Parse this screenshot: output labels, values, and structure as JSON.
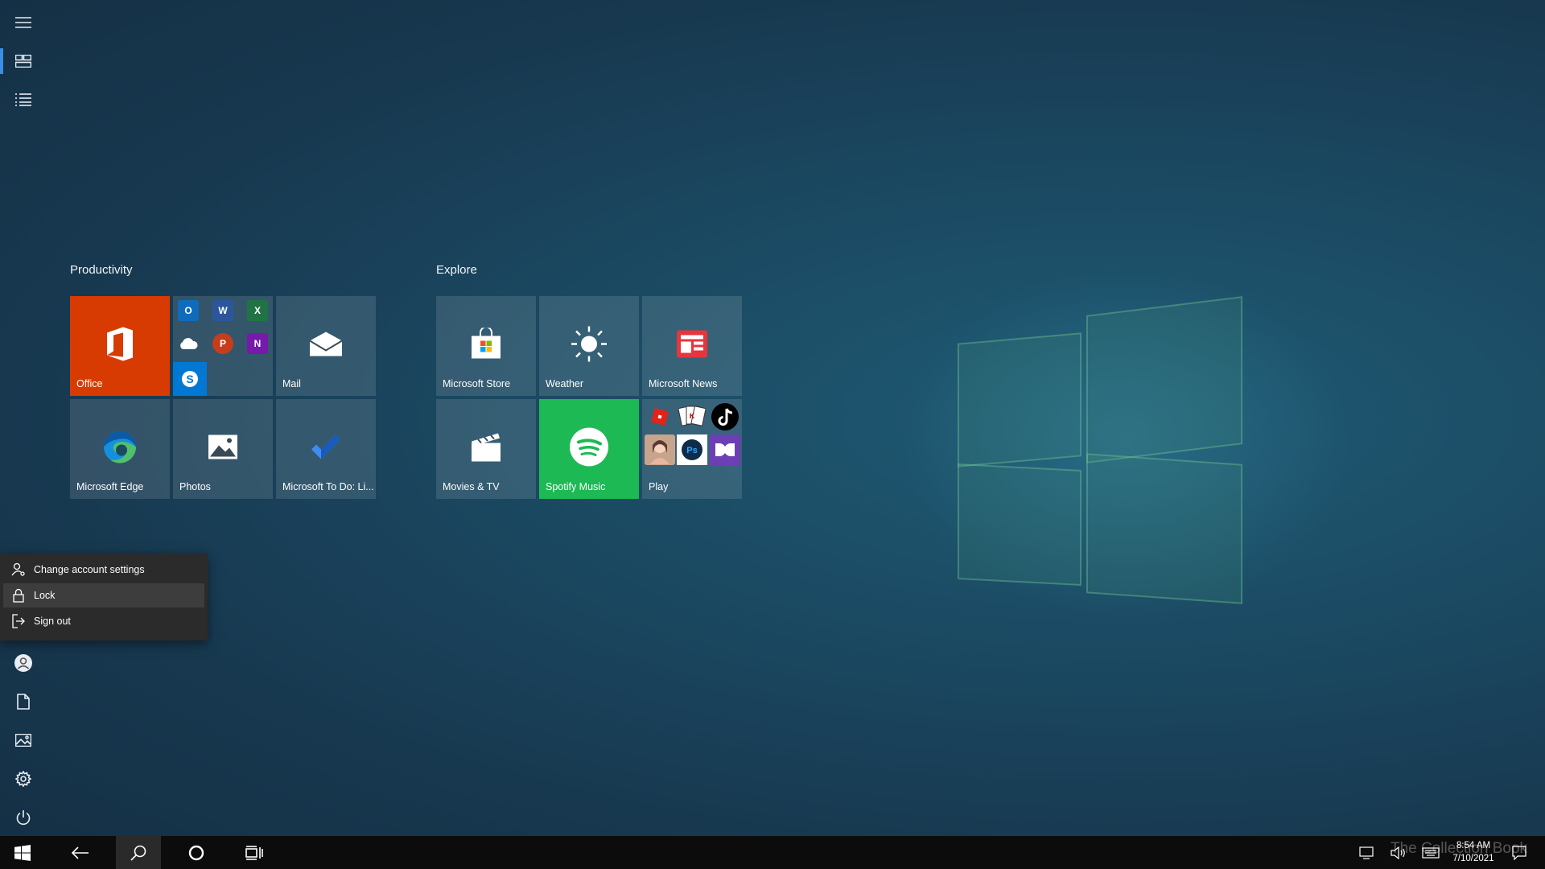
{
  "colors": {
    "office_tile": "#d83b01",
    "spotify_tile": "#1db954",
    "accent": "#3a8ee6",
    "menu_bg": "#2b2b2b",
    "taskbar_bg": "#0c0c0c"
  },
  "groups": [
    {
      "title": "Productivity",
      "tiles": [
        {
          "label": "Office",
          "icon": "office-icon"
        },
        {
          "label": "",
          "icon": "office-apps-folder-icon",
          "apps": [
            "outlook-icon",
            "word-icon",
            "excel-icon",
            "onedrive-icon",
            "powerpoint-icon",
            "onenote-icon",
            "skype-icon"
          ]
        },
        {
          "label": "Mail",
          "icon": "mail-icon"
        },
        {
          "label": "Microsoft Edge",
          "icon": "edge-icon"
        },
        {
          "label": "Photos",
          "icon": "photos-icon"
        },
        {
          "label": "Microsoft To Do: Li...",
          "icon": "todo-checkmark-icon"
        }
      ]
    },
    {
      "title": "Explore",
      "tiles": [
        {
          "label": "Microsoft Store",
          "icon": "store-bag-icon"
        },
        {
          "label": "Weather",
          "icon": "sun-icon"
        },
        {
          "label": "Microsoft News",
          "icon": "news-icon"
        },
        {
          "label": "Movies & TV",
          "icon": "clapperboard-icon"
        },
        {
          "label": "Spotify Music",
          "icon": "spotify-icon"
        },
        {
          "label": "Play",
          "icon": "play-folder-icon",
          "apps": [
            "roblox-icon",
            "solitaire-icon",
            "tiktok-icon",
            "game-portrait-icon",
            "photoshop-express-icon",
            "dolby-icon"
          ]
        }
      ]
    }
  ],
  "rail": {
    "top": [
      "hamburger-menu-icon",
      "tiles-view-icon",
      "all-apps-list-icon"
    ],
    "bottom": [
      "user-account-icon",
      "documents-icon",
      "pictures-icon",
      "settings-gear-icon",
      "power-icon"
    ]
  },
  "account_menu": {
    "items": [
      {
        "label": "Change account settings",
        "icon": "person-settings-icon"
      },
      {
        "label": "Lock",
        "icon": "lock-icon"
      },
      {
        "label": "Sign out",
        "icon": "sign-out-icon"
      }
    ]
  },
  "taskbar": {
    "buttons": [
      "windows-start-icon",
      "back-arrow-icon",
      "search-icon",
      "cortana-icon",
      "task-view-icon"
    ],
    "tray": [
      "tablet-mode-icon",
      "volume-icon",
      "keyboard-icon",
      "action-center-icon"
    ],
    "time": "8:54 AM",
    "date": "7/10/2021"
  },
  "watermark": "The Collection Book"
}
